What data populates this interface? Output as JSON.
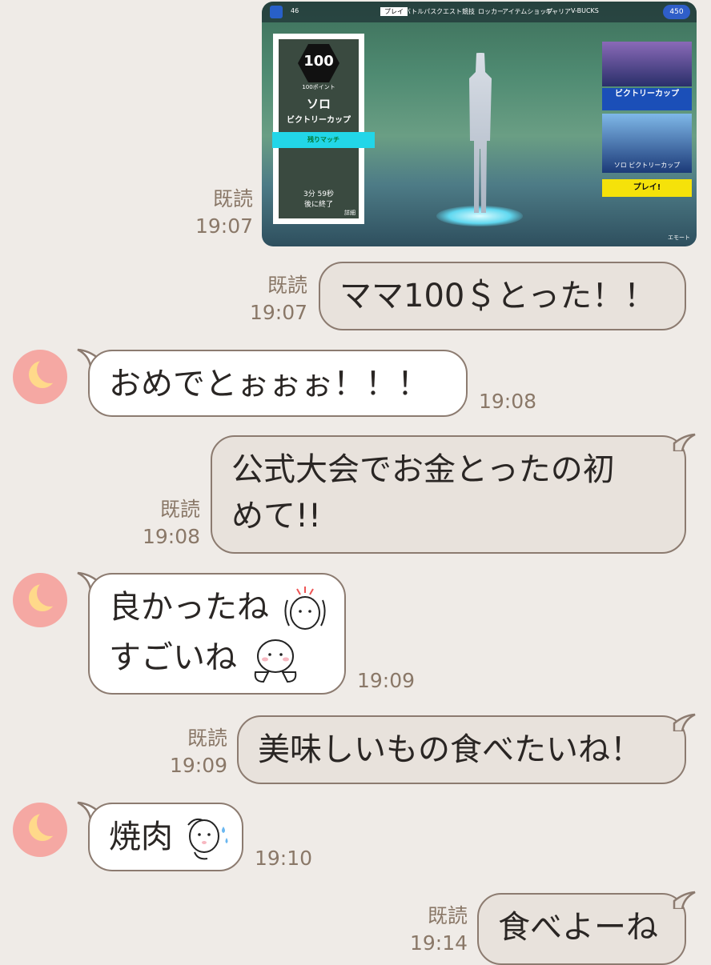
{
  "messages": [
    {
      "side": "out",
      "type": "image",
      "read": "既読",
      "time": "19:07"
    },
    {
      "side": "out",
      "text": "ママ100＄とった！！",
      "read": "既読",
      "time": "19:07"
    },
    {
      "side": "in",
      "text": "おめでとぉぉぉ！！！",
      "time": "19:08"
    },
    {
      "side": "out",
      "line1": "公式大会でお金とったの初",
      "line2": "めて!!",
      "read": "既読",
      "time": "19:08"
    },
    {
      "side": "in",
      "line1": "良かったね",
      "line2": "すごいね",
      "time": "19:09"
    },
    {
      "side": "out",
      "text": "美味しいもの食べたいね！",
      "read": "既読",
      "time": "19:09"
    },
    {
      "side": "in",
      "text": "焼肉",
      "time": "19:10"
    },
    {
      "side": "out",
      "text": "食べよーね",
      "read": "既読",
      "time": "19:14"
    }
  ],
  "screenshot": {
    "vbucks_top": "46",
    "tabs": [
      "プレイ",
      "バトルパス",
      "クエスト",
      "競技",
      "ロッカー",
      "アイテムショップ",
      "キャリア",
      "V-BUCKS"
    ],
    "vbucks": "450",
    "points": "100",
    "points_label": "100ポイント",
    "event_title": "ソロ",
    "event_subtitle": "ビクトリーカップ",
    "cyan_label": "残りマッチ",
    "timer_line1": "3分 59秒",
    "timer_line2": "後に終了",
    "details": "詳細",
    "right_sub": "ソロ ビクトリーカップ",
    "play_button": "プレイ!",
    "emote": "エモート"
  },
  "colors": {
    "background": "#efebe7",
    "outgoing_bubble": "#e8e2dc",
    "incoming_bubble": "#ffffff",
    "avatar": "#f5a8a3"
  }
}
